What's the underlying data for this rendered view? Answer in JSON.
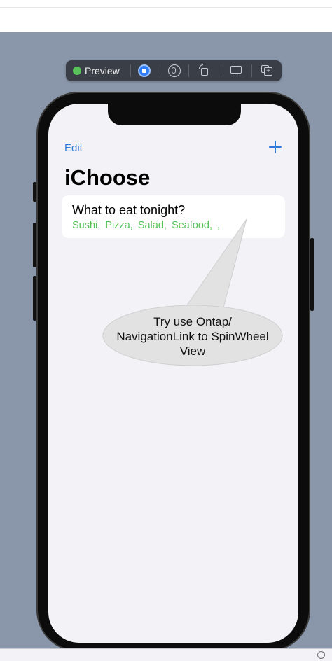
{
  "toolbar": {
    "preview_label": "Preview",
    "live_status_color": "#5ac25b",
    "icons": [
      "live-mode-icon",
      "variants-icon",
      "rotate-icon",
      "device-settings-icon",
      "duplicate-preview-icon"
    ]
  },
  "app": {
    "nav": {
      "edit_label": "Edit",
      "add_icon": "plus-icon"
    },
    "title": "iChoose",
    "list": [
      {
        "title": "What to eat tonight?",
        "options": [
          "Sushi,",
          "Pizza,",
          "Salad,",
          "Seafood,",
          ","
        ]
      }
    ],
    "accent_color": "#2f7bd9",
    "option_color": "#56c15a"
  },
  "annotation": {
    "lines": [
      "Try use Ontap/",
      "NavigationLink to SpinWheel",
      "View"
    ]
  }
}
